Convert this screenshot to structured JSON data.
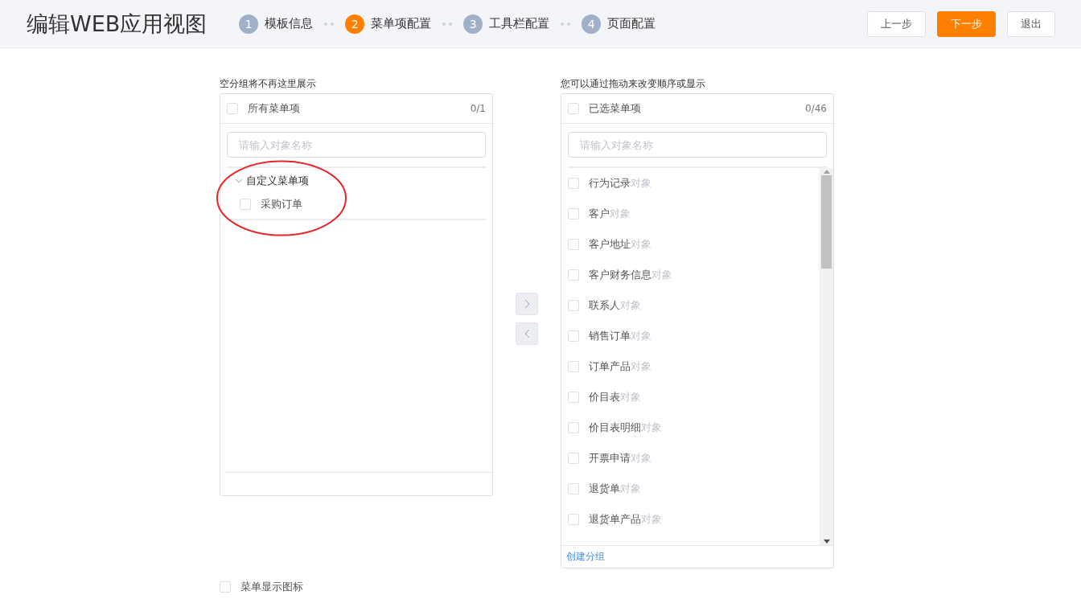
{
  "title": "编辑WEB应用视图",
  "steps": [
    {
      "number": "1",
      "label": "模板信息",
      "selected": false
    },
    {
      "number": "2",
      "label": "菜单项配置",
      "selected": true
    },
    {
      "number": "3",
      "label": "工具栏配置",
      "selected": false
    },
    {
      "number": "4",
      "label": "页面配置",
      "selected": false
    }
  ],
  "buttons": [
    {
      "label": "上一步",
      "kind": "default"
    },
    {
      "label": "下一步",
      "kind": "primary"
    },
    {
      "label": "退出",
      "kind": "default"
    }
  ],
  "left_panel": {
    "caption": "空分组将不再这里展示",
    "header": {
      "label": "所有菜单项",
      "checked": false,
      "count": "0/1"
    },
    "search": {
      "placeholder": "请输入对象名称"
    },
    "tree": [
      {
        "label": "自定义菜单项",
        "expanded": true,
        "children": [
          {
            "label": "采购订单",
            "checked": false
          }
        ]
      }
    ]
  },
  "right_panel": {
    "caption": "您可以通过拖动来改变顺序或显示",
    "header": {
      "label": "已选菜单项",
      "checked": false,
      "count": "0/46"
    },
    "search": {
      "placeholder": "请输入对象名称"
    },
    "items": [
      {
        "label": "行为记录",
        "suffix": "对象",
        "checked": false
      },
      {
        "label": "客户",
        "suffix": "对象",
        "checked": false
      },
      {
        "label": "客户地址",
        "suffix": "对象",
        "checked": false
      },
      {
        "label": "客户财务信息",
        "suffix": "对象",
        "checked": false
      },
      {
        "label": "联系人",
        "suffix": "对象",
        "checked": false
      },
      {
        "label": "销售订单",
        "suffix": "对象",
        "checked": false
      },
      {
        "label": "订单产品",
        "suffix": "对象",
        "checked": false
      },
      {
        "label": "价目表",
        "suffix": "对象",
        "checked": false
      },
      {
        "label": "价目表明细",
        "suffix": "对象",
        "checked": false
      },
      {
        "label": "开票申请",
        "suffix": "对象",
        "checked": false
      },
      {
        "label": "退货单",
        "suffix": "对象",
        "checked": false
      },
      {
        "label": "退货单产品",
        "suffix": "对象",
        "checked": false
      }
    ],
    "footer_link": "创建分组"
  },
  "show_icons_option": {
    "label": "菜单显示图标",
    "checked": false
  }
}
